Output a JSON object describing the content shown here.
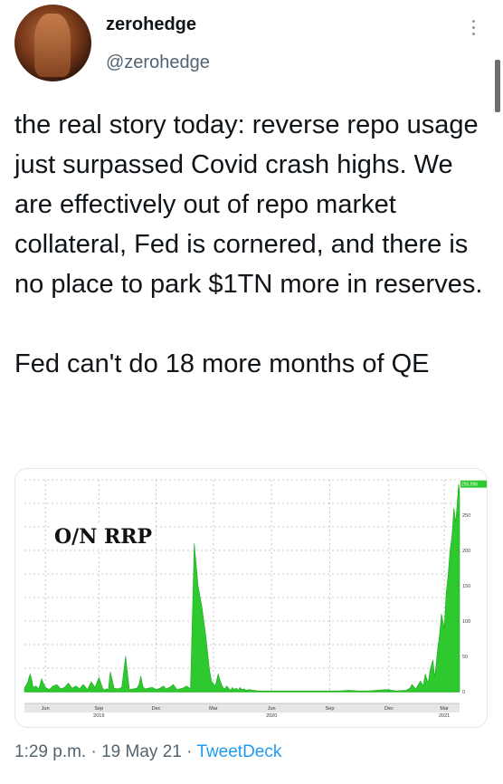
{
  "tweet": {
    "display_name": "zerohedge",
    "handle": "@zerohedge",
    "text": "the real story today: reverse repo usage just surpassed Covid crash highs. We are effectively out of repo market collateral, Fed is cornered, and there is no place to park $1TN more in reserves.\n\nFed can't do 18 more months of QE",
    "time": "1:29 p.m.",
    "separator": "·",
    "date": "19 May 21",
    "source": "TweetDeck"
  },
  "icons": {
    "more": "more-vertical-icon",
    "avatar": "profile-avatar"
  },
  "colors": {
    "accent": "#1d9bf0",
    "series": "#2ec92e",
    "muted": "#536471"
  },
  "chart_data": {
    "type": "area",
    "title": "O/N RRP",
    "x_ticks": [
      "Jun",
      "Sep",
      "Dec",
      "Mar",
      "Jun",
      "Sep",
      "Dec",
      "Mar"
    ],
    "x_year_labels": [
      {
        "label": "2019",
        "under": "Sep"
      },
      {
        "label": "2020",
        "under": "Jun"
      },
      {
        "label": "2021",
        "under": "Mar"
      }
    ],
    "y_ticks": [
      0,
      50,
      100,
      150,
      200,
      250
    ],
    "ylim": [
      0,
      300
    ],
    "y_axis_side": "right",
    "last_value_label": "293.996",
    "grid": true,
    "series": [
      {
        "x": [
          0,
          3,
          6,
          8,
          9,
          12,
          15,
          18,
          22,
          26,
          30,
          34,
          38,
          42,
          46,
          50,
          54,
          58,
          60,
          62,
          66,
          70,
          74,
          78,
          82,
          84,
          86,
          88,
          90,
          94,
          98,
          102,
          106,
          110,
          114,
          118,
          120,
          122,
          124,
          126,
          130,
          134,
          138,
          142,
          146,
          148,
          152,
          156,
          160,
          166,
          170,
          174,
          178,
          182,
          186,
          190,
          194,
          196,
          200,
          203,
          206,
          208,
          210,
          212,
          214,
          216,
          218,
          220,
          222,
          224,
          226,
          228,
          230,
          232,
          235,
          240,
          245,
          250,
          260,
          270,
          280,
          290,
          300,
          310,
          320,
          330,
          340,
          350,
          360,
          370,
          380,
          390,
          400,
          404,
          406,
          410,
          415,
          418,
          420,
          423,
          425,
          428,
          430,
          433,
          435,
          437,
          440,
          442,
          444,
          446,
          448,
          450,
          452,
          454,
          455,
          456
        ],
        "y": [
          5,
          12,
          25,
          15,
          6,
          8,
          4,
          18,
          6,
          3,
          8,
          10,
          4,
          6,
          12,
          5,
          8,
          4,
          8,
          10,
          3,
          14,
          6,
          20,
          5,
          2,
          4,
          3,
          28,
          5,
          4,
          6,
          50,
          3,
          4,
          5,
          10,
          22,
          8,
          4,
          5,
          6,
          3,
          5,
          8,
          4,
          6,
          10,
          3,
          5,
          8,
          4,
          210,
          150,
          120,
          80,
          30,
          15,
          8,
          25,
          12,
          6,
          4,
          8,
          5,
          2,
          6,
          3,
          5,
          2,
          6,
          3,
          4,
          2,
          3,
          2,
          1,
          1,
          1,
          1,
          1,
          1,
          1,
          1,
          1,
          1,
          2,
          1,
          1,
          2,
          3,
          1,
          2,
          5,
          10,
          4,
          15,
          8,
          25,
          12,
          30,
          45,
          20,
          60,
          80,
          110,
          90,
          140,
          165,
          200,
          220,
          260,
          240,
          275,
          294,
          285
        ]
      }
    ]
  }
}
